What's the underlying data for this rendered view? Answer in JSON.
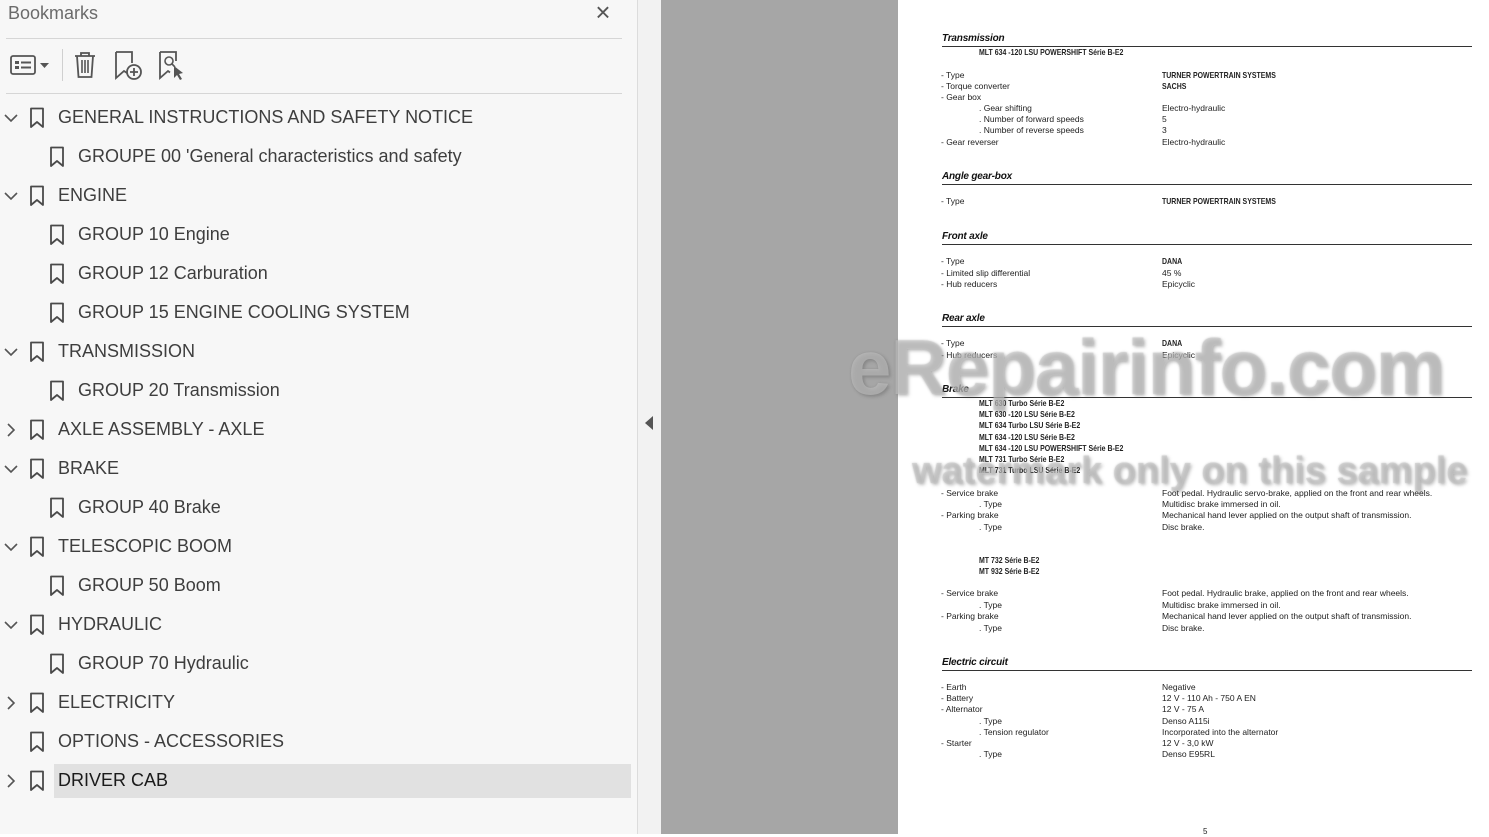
{
  "panel": {
    "title": "Bookmarks",
    "close": "×"
  },
  "icons": [
    "options-menu-icon",
    "delete-bookmark-icon",
    "new-bookmark-icon",
    "find-current-bookmark-icon",
    "bookmark-icon",
    "chevron-down-icon",
    "chevron-right-icon",
    "collapse-pane-arrow-icon"
  ],
  "bookmarks": [
    {
      "level": 0,
      "expand": "down",
      "label": "GENERAL INSTRUCTIONS AND SAFETY NOTICE"
    },
    {
      "level": 1,
      "expand": "",
      "label": "GROUPE 00  'General characteristics and safety"
    },
    {
      "level": 0,
      "expand": "down",
      "label": "ENGINE"
    },
    {
      "level": 1,
      "expand": "",
      "label": "GROUP 10  Engine"
    },
    {
      "level": 1,
      "expand": "",
      "label": "GROUP 12  Carburation"
    },
    {
      "level": 1,
      "expand": "",
      "label": "GROUP 15  ENGINE COOLING SYSTEM"
    },
    {
      "level": 0,
      "expand": "down",
      "label": "TRANSMISSION"
    },
    {
      "level": 1,
      "expand": "",
      "label": "GROUP 20  Transmission"
    },
    {
      "level": 0,
      "expand": "right",
      "label": "AXLE ASSEMBLY - AXLE"
    },
    {
      "level": 0,
      "expand": "down",
      "label": "BRAKE"
    },
    {
      "level": 1,
      "expand": "",
      "label": "GROUP 40 Brake"
    },
    {
      "level": 0,
      "expand": "down",
      "label": "TELESCOPIC BOOM"
    },
    {
      "level": 1,
      "expand": "",
      "label": "GROUP 50 Boom"
    },
    {
      "level": 0,
      "expand": "down",
      "label": "HYDRAULIC"
    },
    {
      "level": 1,
      "expand": "",
      "label": "GROUP 70 Hydraulic"
    },
    {
      "level": 0,
      "expand": "right",
      "label": "ELECTRICITY"
    },
    {
      "level": 0,
      "expand": "",
      "label": "OPTIONS - ACCESSORIES"
    },
    {
      "level": 0,
      "expand": "right",
      "label": "DRIVER CAB",
      "selected": true
    }
  ],
  "doc": {
    "transmission": {
      "title": "Transmission",
      "model": "MLT 634 -120 LSU POWERSHIFT Série B-E2",
      "rows": [
        {
          "label": "- Type",
          "value": "TURNER POWERTRAIN SYSTEMS",
          "bold": true
        },
        {
          "label": "- Torque converter",
          "value": "SACHS",
          "bold": true
        },
        {
          "label": "- Gear box",
          "value": ""
        },
        {
          "label": ". Gear shifting",
          "value": "Electro-hydraulic",
          "indent": true
        },
        {
          "label": ". Number of forward speeds",
          "value": "5",
          "indent": true
        },
        {
          "label": ". Number of reverse speeds",
          "value": "3",
          "indent": true
        },
        {
          "label": "- Gear reverser",
          "value": "Electro-hydraulic"
        }
      ]
    },
    "angle_gearbox": {
      "title": "Angle gear-box",
      "rows": [
        {
          "label": "- Type",
          "value": "TURNER POWERTRAIN SYSTEMS",
          "bold": true
        }
      ]
    },
    "front_axle": {
      "title": "Front axle",
      "rows": [
        {
          "label": "- Type",
          "value": "DANA",
          "bold": true
        },
        {
          "label": "- Limited slip differential",
          "value": "45 %"
        },
        {
          "label": "- Hub reducers",
          "value": "Epicyclic"
        }
      ]
    },
    "rear_axle": {
      "title": "Rear axle",
      "rows": [
        {
          "label": "- Type",
          "value": "DANA",
          "bold": true
        },
        {
          "label": "- Hub reducers",
          "value": "Epicyclic"
        }
      ]
    },
    "brake": {
      "title": "Brake",
      "models_a": [
        "MLT 630 Turbo Série B-E2",
        "MLT 630 -120 LSU Série B-E2",
        "MLT 634 Turbo LSU Série B-E2",
        "MLT 634 -120 LSU Série B-E2",
        "MLT 634 -120 LSU POWERSHIFT Série B-E2",
        "MLT 731 Turbo Série B-E2",
        "MLT 731 Turbo LSU Série B-E2"
      ],
      "rows_a": [
        {
          "label": "- Service brake",
          "value": "Foot pedal. Hydraulic servo-brake, applied on the front and rear wheels."
        },
        {
          "label": ". Type",
          "value": "Multidisc brake immersed in oil.",
          "indent": true
        },
        {
          "label": "- Parking brake",
          "value": "Mechanical hand lever applied on the output shaft of transmission."
        },
        {
          "label": ". Type",
          "value": "Disc brake.",
          "indent": true
        }
      ],
      "models_b": [
        "MT 732 Série B-E2",
        "MT 932 Série B-E2"
      ],
      "rows_b": [
        {
          "label": "- Service brake",
          "value": "Foot pedal. Hydraulic brake, applied on the front and rear wheels."
        },
        {
          "label": ". Type",
          "value": "Multidisc brake immersed in oil.",
          "indent": true
        },
        {
          "label": "- Parking brake",
          "value": "Mechanical hand lever applied on the output shaft of transmission."
        },
        {
          "label": ". Type",
          "value": "Disc brake.",
          "indent": true
        }
      ]
    },
    "electric": {
      "title": "Electric circuit",
      "rows": [
        {
          "label": "- Earth",
          "value": "Negative"
        },
        {
          "label": "- Battery",
          "value": "12 V - 110 Ah - 750 A EN"
        },
        {
          "label": "- Alternator",
          "value": "12 V - 75 A"
        },
        {
          "label": ". Type",
          "value": "Denso A115i",
          "indent": true
        },
        {
          "label": ". Tension regulator",
          "value": "Incorporated into the alternator",
          "indent": true
        },
        {
          "label": "- Starter",
          "value": "12 V - 3,0 kW"
        },
        {
          "label": ". Type",
          "value": "Denso E95RL",
          "indent": true
        }
      ]
    },
    "page_number": "5"
  },
  "watermark": {
    "line1": "eRepairinfo.com",
    "line2": "watermark only on this sample"
  }
}
